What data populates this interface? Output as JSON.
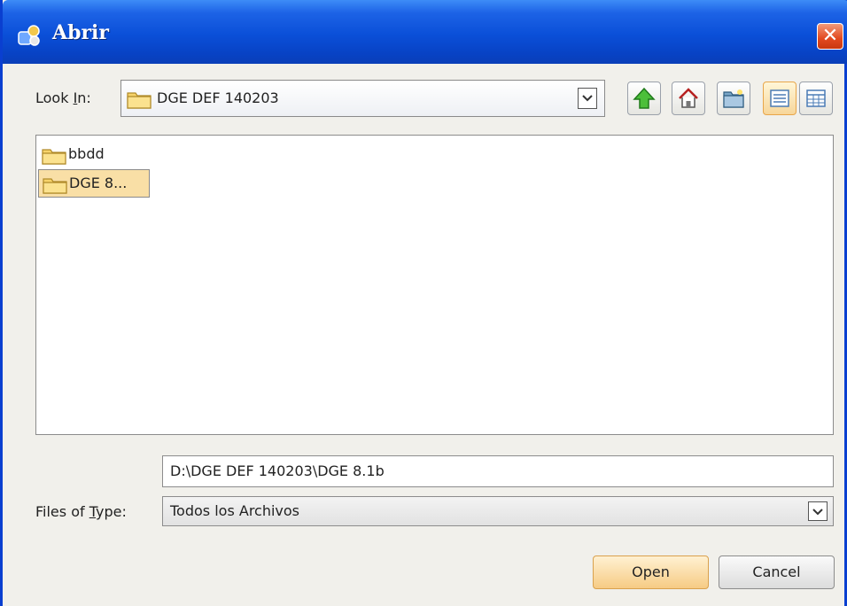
{
  "window": {
    "title": "Abrir",
    "close_glyph": "✕",
    "accent": "#0a4fd8"
  },
  "look_in": {
    "label_pre": "Look ",
    "label_mnemonic": "I",
    "label_post": "n:",
    "value": "DGE DEF 140203"
  },
  "toolbar": {
    "icons": [
      "up-folder-icon",
      "home-icon",
      "new-folder-icon",
      "list-view-icon",
      "details-view-icon"
    ]
  },
  "files": [
    {
      "name": "bbdd",
      "selected": false
    },
    {
      "name": "DGE 8...",
      "selected": true
    }
  ],
  "path_field": {
    "value": "D:\\DGE DEF 140203\\DGE 8.1b"
  },
  "files_of_type": {
    "label_pre": "Files of ",
    "label_mnemonic": "T",
    "label_post": "ype:",
    "value": "Todos los Archivos"
  },
  "buttons": {
    "open": "Open",
    "cancel": "Cancel"
  }
}
